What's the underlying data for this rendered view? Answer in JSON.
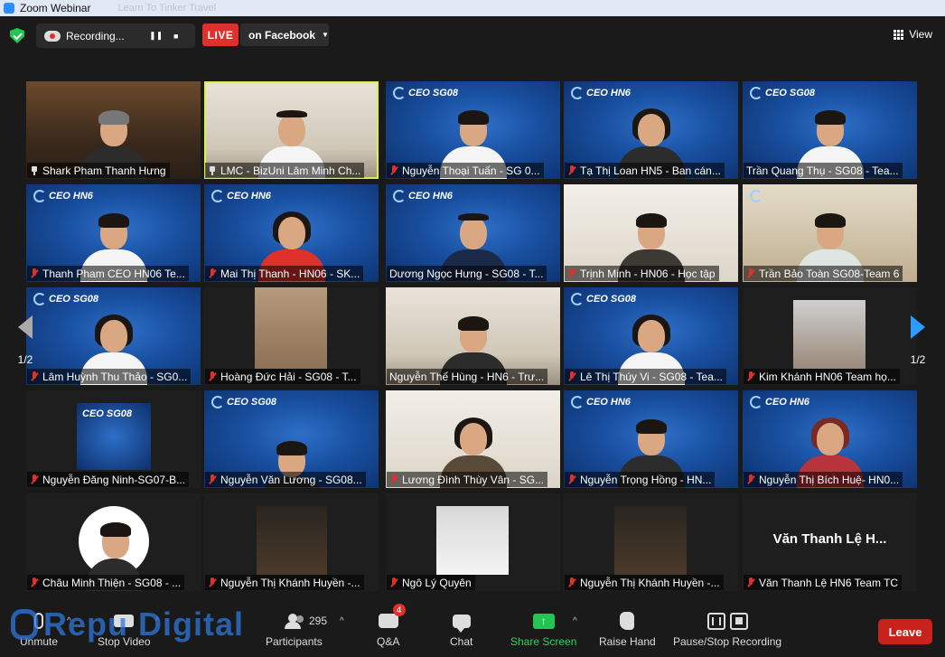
{
  "window": {
    "title": "Zoom Webinar",
    "ghost_title": "Learn To Tinker Travel"
  },
  "topbar": {
    "recording_label": "Recording...",
    "live_label": "LIVE",
    "stream_target": "on Facebook",
    "view_label": "View"
  },
  "pager": {
    "left_page": "1/2",
    "right_page": "1/2"
  },
  "tiles": [
    {
      "name": "Shark Pham Thanh Hưng",
      "status": "pinned"
    },
    {
      "name": "LMC - BizUni Lâm Minh Ch...",
      "status": "pinned"
    },
    {
      "name": "Nguyễn Thoại Tuấn - SG 0...",
      "status": "muted"
    },
    {
      "name": "Tạ Thị Loan HN5 - Ban cán...",
      "status": "muted"
    },
    {
      "name": "Trần Quang Thụ - SG08 - Tea...",
      "status": "none"
    },
    {
      "name": "Thanh Pham CEO HN06 Te...",
      "status": "muted"
    },
    {
      "name": "Mai Thị Thanh - HN06 - SK...",
      "status": "muted"
    },
    {
      "name": "Dương Ngọc Hưng - SG08 - T...",
      "status": "none"
    },
    {
      "name": "Trịnh Minh - HN06 - Học tập",
      "status": "muted"
    },
    {
      "name": "Trần Bảo Toàn SG08-Team 6",
      "status": "muted"
    },
    {
      "name": "Lâm Huỳnh Thu Thảo - SG0...",
      "status": "muted"
    },
    {
      "name": "Hoàng Đức Hải - SG08 - T...",
      "status": "muted"
    },
    {
      "name": "Nguyễn Thế Hùng - HN6 - Trư...",
      "status": "none"
    },
    {
      "name": "Lê Thị Thúy Vi - SG08 - Tea...",
      "status": "muted"
    },
    {
      "name": "Kim Khánh HN06 Team họ...",
      "status": "muted"
    },
    {
      "name": "Nguyễn Đăng Ninh-SG07-B...",
      "status": "muted"
    },
    {
      "name": "Nguyễn Văn Lương - SG08...",
      "status": "muted"
    },
    {
      "name": "Lương Đình Thùy Vân - SG...",
      "status": "muted"
    },
    {
      "name": "Nguyễn Trọng Hồng - HN...",
      "status": "muted"
    },
    {
      "name": "Nguyễn Thị Bích Huệ- HN0...",
      "status": "muted"
    },
    {
      "name": "Châu Minh Thiện - SG08 - ...",
      "status": "muted"
    },
    {
      "name": "Nguyễn Thị Khánh Huyền -...",
      "status": "muted"
    },
    {
      "name": "Ngô Lý Quyên",
      "status": "muted"
    },
    {
      "name": "Nguyễn Thị Khánh Huyền -...",
      "status": "muted"
    },
    {
      "name": "Văn Thanh Lệ HN6 Team TC",
      "status": "muted",
      "display_name": "Văn Thanh Lệ H..."
    }
  ],
  "logos": {
    "sg": "CEO SG08",
    "hn": "CEO HN6"
  },
  "toolbar": {
    "unmute": "Unmute",
    "stop_video": "Stop Video",
    "participants": "Participants",
    "participants_count": "295",
    "qa": "Q&A",
    "qa_badge": "4",
    "chat": "Chat",
    "share_screen": "Share Screen",
    "raise_hand": "Raise Hand",
    "pause_stop_recording": "Pause/Stop Recording",
    "leave": "Leave"
  },
  "watermark": "Repu Digital",
  "colors": {
    "live": "#e0302c",
    "share": "#23c552",
    "leave": "#c7221c",
    "active_speaker": "#d8f24a",
    "pager_right": "#2d9bff"
  }
}
